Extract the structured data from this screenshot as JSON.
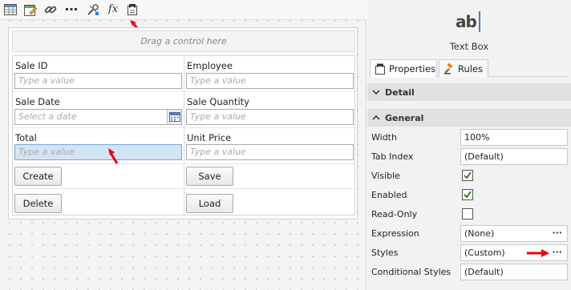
{
  "toolbar": {
    "icons": [
      "table-grid-icon",
      "edit-form-icon",
      "link-icon",
      "more-dots-icon",
      "tools-icon",
      "fx-icon",
      "control-pointer-icon"
    ],
    "fx_label": "fx"
  },
  "canvas": {
    "drop_hint": "Drag a control here",
    "fields": {
      "sale_id": {
        "label": "Sale ID",
        "placeholder": "Type a value"
      },
      "employee": {
        "label": "Employee",
        "placeholder": "Type a value"
      },
      "sale_date": {
        "label": "Sale Date",
        "placeholder": "Select a date"
      },
      "sale_quantity": {
        "label": "Sale Quantity",
        "placeholder": "Type a value"
      },
      "total": {
        "label": "Total",
        "placeholder": "Type a value"
      },
      "unit_price": {
        "label": "Unit Price",
        "placeholder": "Type a value"
      }
    },
    "buttons": {
      "create": "Create",
      "save": "Save",
      "delete": "Delete",
      "load": "Load"
    }
  },
  "panel": {
    "control_icon_text": "ab",
    "control_name": "Text Box",
    "tabs": [
      {
        "label": "Properties",
        "active": true
      },
      {
        "label": "Rules",
        "active": false
      }
    ],
    "sections": {
      "detail": "Detail",
      "general": "General"
    },
    "properties": {
      "width": {
        "name": "Width",
        "value": "100%"
      },
      "tab_index": {
        "name": "Tab Index",
        "value": "(Default)"
      },
      "visible": {
        "name": "Visible",
        "checked": true
      },
      "enabled": {
        "name": "Enabled",
        "checked": true
      },
      "read_only": {
        "name": "Read-Only",
        "checked": false
      },
      "expression": {
        "name": "Expression",
        "value": "(None)",
        "ellipsis": "···"
      },
      "styles": {
        "name": "Styles",
        "value": "(Custom)",
        "ellipsis": "···"
      },
      "conditional_styles": {
        "name": "Conditional Styles",
        "value": "(Default)"
      }
    }
  },
  "colors": {
    "selected_field": "#d3e4f4",
    "annotation_arrow": "#e8000b",
    "caret": "#4a7fc0"
  }
}
